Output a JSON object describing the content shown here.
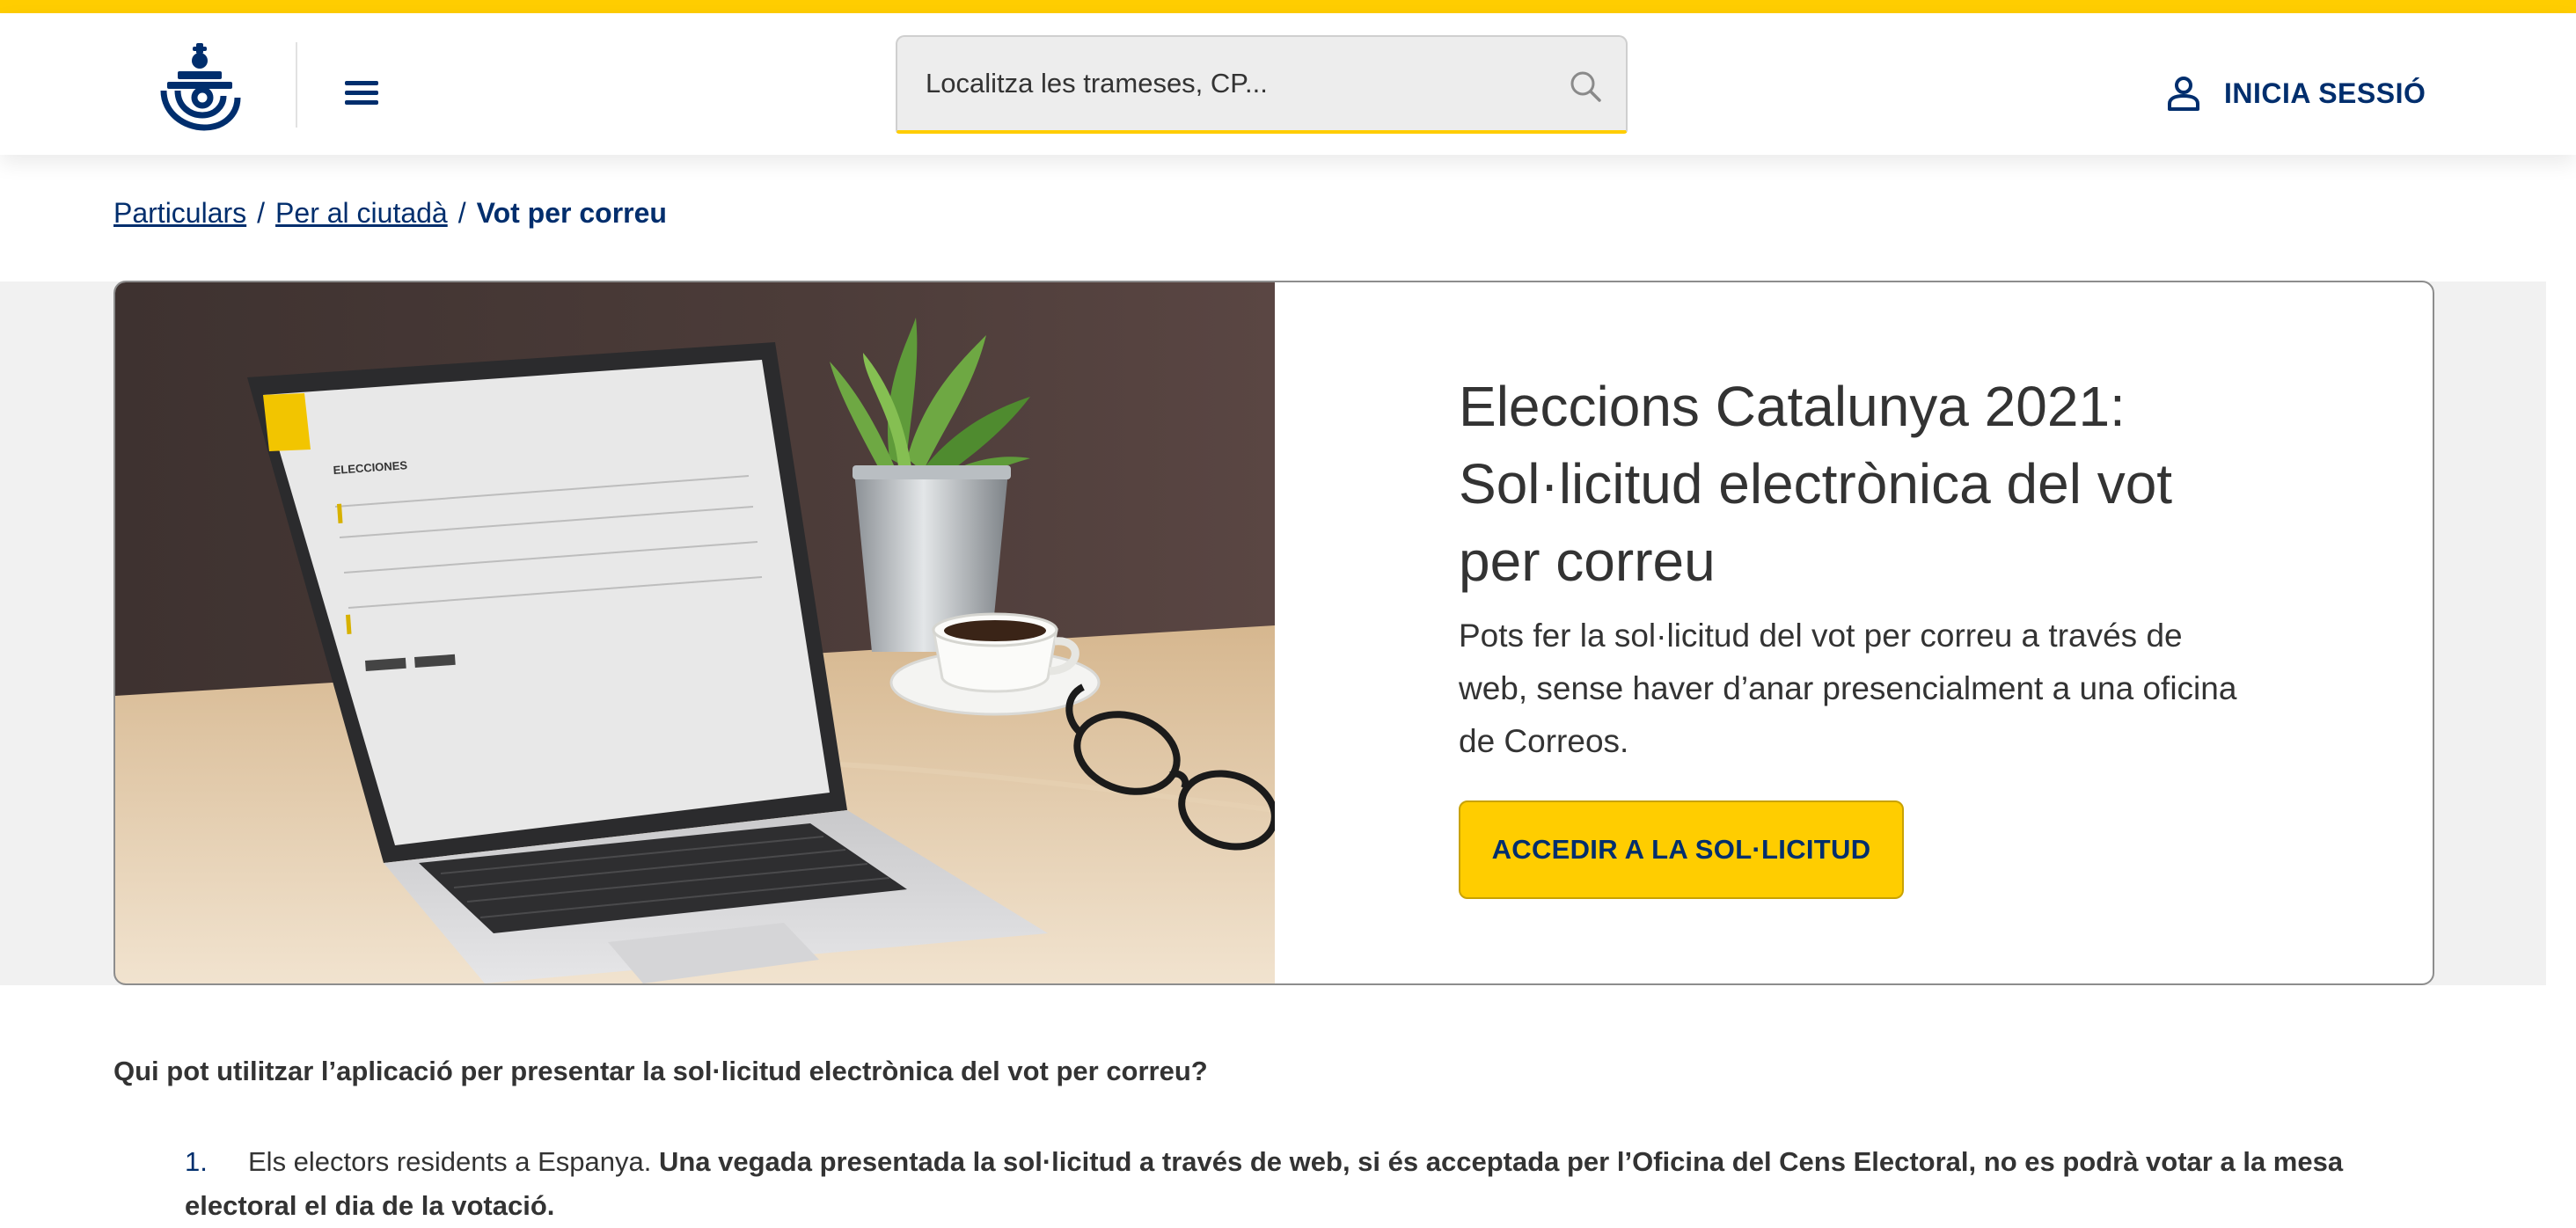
{
  "header": {
    "logo_icon": "correos-horn-crown-icon",
    "menu_icon": "hamburger-menu-icon",
    "search_placeholder": "Localitza les trameses, CP...",
    "search_icon": "search-icon",
    "login_icon": "user-icon",
    "login_label": "INICIA SESSIÓ"
  },
  "breadcrumb": {
    "items": [
      {
        "label": "Particulars"
      },
      {
        "label": "Per al ciutadà"
      }
    ],
    "separator": "/",
    "current": "Vot per correu"
  },
  "hero": {
    "image_description": "laptop-with-elections-form-photo",
    "title": "Eleccions Catalunya 2021: Sol·licitud electrònica del vot per correu",
    "description": "Pots fer la sol·licitud del vot per correu a través de web, sense haver d’anar presencialment a una oficina de Correos.",
    "cta_label": "ACCEDIR A LA SOL·LICITUD"
  },
  "content": {
    "question": "Qui pot utilitzar l’aplicació per presentar la sol·licitud electrònica del vot per correu?",
    "list": [
      {
        "number": "1.",
        "text": "Els electors residents a Espanya. ",
        "bold_text": "Una vegada presentada la sol·licitud a través de web, si és acceptada per l’Oficina del Cens Electoral, no es podrà votar a la mesa electoral el dia de la votació."
      }
    ]
  },
  "colors": {
    "brand_yellow": "#FFCD00",
    "brand_blue": "#002E6D",
    "text": "#333333"
  }
}
